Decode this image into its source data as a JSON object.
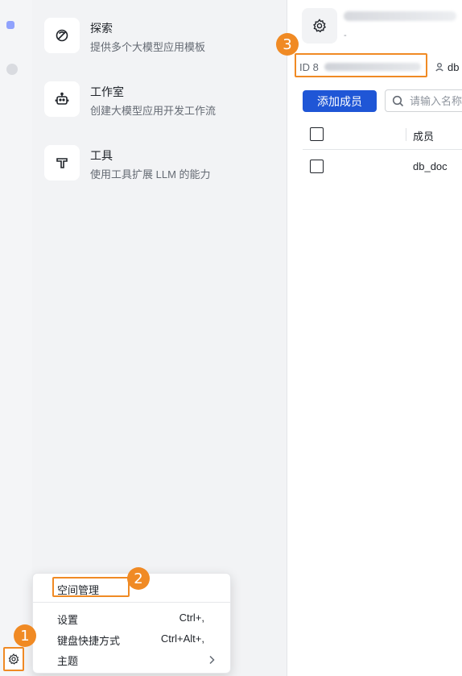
{
  "menu": [
    {
      "title": "探索",
      "desc": "提供多个大模型应用模板",
      "icon": "compass-icon"
    },
    {
      "title": "工作室",
      "desc": "创建大模型应用开发工作流",
      "icon": "robot-icon"
    },
    {
      "title": "工具",
      "desc": "使用工具扩展 LLM 的能力",
      "icon": "hammer-icon"
    }
  ],
  "workspace": {
    "sub": "-",
    "id_label": "ID 8",
    "owner": "db"
  },
  "members": {
    "add_button": "添加成员",
    "search_placeholder": "请输入名称",
    "column_member": "成员",
    "rows": [
      {
        "name": "db_doc"
      }
    ]
  },
  "popup": {
    "space_manage": "空间管理",
    "settings": "设置",
    "settings_shortcut": "Ctrl+,",
    "keyboard": "键盘快捷方式",
    "keyboard_shortcut": "Ctrl+Alt+,",
    "theme": "主题"
  },
  "badges": [
    "1",
    "2",
    "3"
  ],
  "colors": {
    "accent": "#f08a24",
    "primary": "#1f56d6"
  }
}
